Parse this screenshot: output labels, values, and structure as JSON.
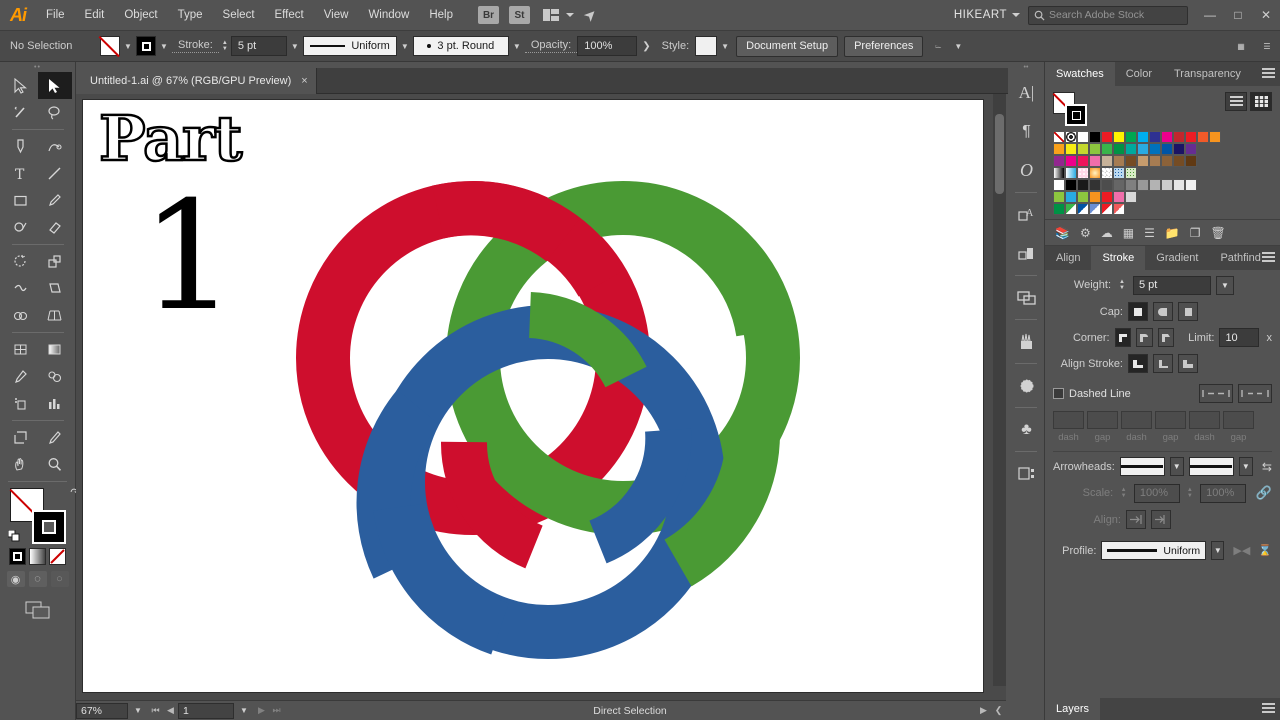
{
  "app": {
    "name": "Adobe Illustrator",
    "logo": "Ai"
  },
  "menubar": {
    "items": [
      "File",
      "Edit",
      "Object",
      "Type",
      "Select",
      "Effect",
      "View",
      "Window",
      "Help"
    ],
    "bridge_label": "Br",
    "stock_label": "St",
    "workspace": "HIKEART",
    "search_placeholder": "Search Adobe Stock"
  },
  "controlbar": {
    "selection_status": "No Selection",
    "stroke_label": "Stroke:",
    "stroke_weight": "5 pt",
    "profile": "Uniform",
    "brush": "3 pt. Round",
    "opacity_label": "Opacity:",
    "opacity_value": "100%",
    "style_label": "Style:",
    "document_setup": "Document Setup",
    "preferences": "Preferences"
  },
  "document": {
    "tab_title": "Untitled-1.ai @ 67% (RGB/GPU Preview)",
    "close_label": "×"
  },
  "artwork": {
    "headline": "Part",
    "number": "1",
    "colors": {
      "red": "#CE0E2D",
      "green": "#4A9A34",
      "blue": "#2B5E9E"
    }
  },
  "statusbar": {
    "zoom": "67%",
    "page": "1",
    "active_tool": "Direct Selection"
  },
  "toolbar": {
    "tools": [
      {
        "name": "selection-tool",
        "label": "Selection",
        "active": false
      },
      {
        "name": "direct-selection-tool",
        "label": "Direct Selection",
        "active": true
      },
      {
        "name": "magic-wand-tool",
        "label": "Magic Wand",
        "active": false
      },
      {
        "name": "lasso-tool",
        "label": "Lasso",
        "active": false
      },
      {
        "name": "pen-tool",
        "label": "Pen",
        "active": false
      },
      {
        "name": "curvature-tool",
        "label": "Curvature",
        "active": false
      },
      {
        "name": "type-tool",
        "label": "Type",
        "active": false
      },
      {
        "name": "line-segment-tool",
        "label": "Line Segment",
        "active": false
      },
      {
        "name": "rectangle-tool",
        "label": "Rectangle",
        "active": false
      },
      {
        "name": "paintbrush-tool",
        "label": "Paintbrush",
        "active": false
      },
      {
        "name": "shaper-tool",
        "label": "Shaper",
        "active": false
      },
      {
        "name": "eraser-tool",
        "label": "Eraser",
        "active": false
      },
      {
        "name": "rotate-tool",
        "label": "Rotate",
        "active": false
      },
      {
        "name": "scale-tool",
        "label": "Scale",
        "active": false
      },
      {
        "name": "width-tool",
        "label": "Width",
        "active": false
      },
      {
        "name": "free-transform-tool",
        "label": "Free Transform",
        "active": false
      },
      {
        "name": "shape-builder-tool",
        "label": "Shape Builder",
        "active": false
      },
      {
        "name": "perspective-grid-tool",
        "label": "Perspective Grid",
        "active": false
      },
      {
        "name": "mesh-tool",
        "label": "Mesh",
        "active": false
      },
      {
        "name": "gradient-tool",
        "label": "Gradient",
        "active": false
      },
      {
        "name": "eyedropper-tool",
        "label": "Eyedropper",
        "active": false
      },
      {
        "name": "blend-tool",
        "label": "Blend",
        "active": false
      },
      {
        "name": "symbol-sprayer-tool",
        "label": "Symbol Sprayer",
        "active": false
      },
      {
        "name": "column-graph-tool",
        "label": "Column Graph",
        "active": false
      },
      {
        "name": "artboard-tool",
        "label": "Artboard",
        "active": false
      },
      {
        "name": "slice-tool",
        "label": "Slice",
        "active": false
      },
      {
        "name": "hand-tool",
        "label": "Hand",
        "active": false
      },
      {
        "name": "zoom-tool",
        "label": "Zoom",
        "active": false
      }
    ]
  },
  "icon_dock": {
    "items": [
      {
        "name": "character-panel-icon",
        "glyph": "A|"
      },
      {
        "name": "paragraph-panel-icon",
        "glyph": "¶"
      },
      {
        "name": "opentype-panel-icon",
        "glyph": "O"
      },
      {
        "name": "appearance-panel-icon",
        "glyph": "A"
      },
      {
        "name": "graphic-styles-panel-icon",
        "glyph": "◧"
      },
      {
        "name": "layers-panel-icon",
        "glyph": "❐"
      },
      {
        "name": "brushes-panel-icon",
        "glyph": "♣"
      },
      {
        "name": "symbols-panel-icon",
        "glyph": "☀"
      },
      {
        "name": "libraries-panel-icon",
        "glyph": "♣"
      },
      {
        "name": "asset-export-panel-icon",
        "glyph": "⧉"
      }
    ]
  },
  "swatches_panel": {
    "tabs": [
      "Swatches",
      "Color",
      "Transparency"
    ],
    "active_tab": "Swatches",
    "rows": [
      [
        "none",
        "registration",
        "#ffffff",
        "#000000",
        "#ed1c24",
        "#fff200",
        "#00a651",
        "#00aeef",
        "#2e3192",
        "#ec008c",
        "#c1272d",
        "#ed1c24",
        "#f15a29",
        "#f7941e"
      ],
      [
        "#f9a11b",
        "#f7ec13",
        "#c4d82e",
        "#8dc63f",
        "#39b54a",
        "#009245",
        "#00a99d",
        "#29abe2",
        "#0071bc",
        "#0054a6",
        "#1b1464",
        "#662d91"
      ],
      [
        "#92278f",
        "#ec008c",
        "#ed145b",
        "#f06eaa",
        "#c7b299",
        "#a67c52",
        "#754c24",
        "#c69c6d",
        "#a67c52",
        "#8c6239",
        "#754c24",
        "#603913"
      ],
      [
        "gradient-white-black",
        "gradient-blue",
        "pattern-dots",
        "gradient-orange",
        "pattern-check",
        "pattern-blue",
        "pattern-green"
      ],
      [
        "#ffffff",
        "#000000",
        "#1a1a1a",
        "#333333",
        "#4d4d4d",
        "#666666",
        "#808080",
        "#999999",
        "#b3b3b3",
        "#cccccc",
        "#e6e6e6",
        "#f2f2f2"
      ],
      [
        "#8dc63f",
        "#29abe2",
        "#8dc63f",
        "#f7941e",
        "#ed1c24",
        "#f06eaa",
        "#d9d9d9"
      ],
      [
        "#009245",
        "#39b54a",
        "#0054a6",
        "#6b8fd4",
        "#ed1c24",
        "#f15a5a"
      ]
    ]
  },
  "stroke_panel": {
    "tabs": [
      "Align",
      "Stroke",
      "Gradient",
      "Pathfind"
    ],
    "active_tab": "Stroke",
    "weight_label": "Weight:",
    "weight_value": "5 pt",
    "cap_label": "Cap:",
    "corner_label": "Corner:",
    "limit_label": "Limit:",
    "limit_value": "10",
    "limit_unit": "x",
    "align_stroke_label": "Align Stroke:",
    "dashed_line_label": "Dashed Line",
    "dash_labels": [
      "dash",
      "gap",
      "dash",
      "gap",
      "dash",
      "gap"
    ],
    "arrowheads_label": "Arrowheads:",
    "scale_label": "Scale:",
    "scale_value_1": "100%",
    "scale_value_2": "100%",
    "align_label": "Align:",
    "profile_label": "Profile:",
    "profile_value": "Uniform"
  },
  "layers_panel": {
    "tab_label": "Layers"
  }
}
